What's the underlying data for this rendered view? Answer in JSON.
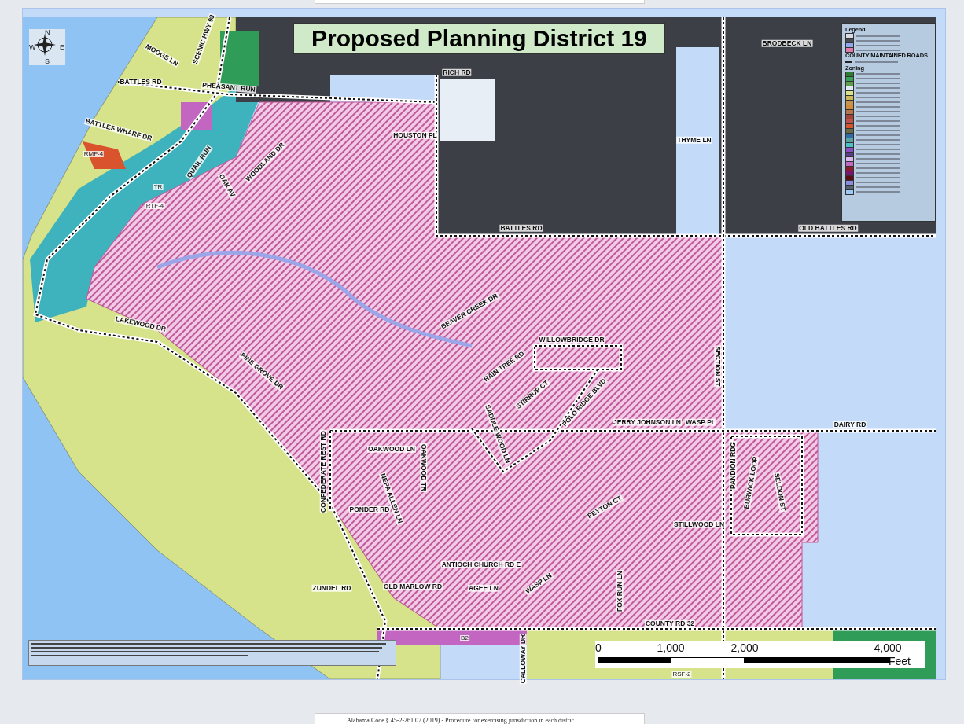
{
  "map": {
    "title": "Proposed Planning District 19",
    "compass": {
      "north": "N",
      "south": "S",
      "east": "E",
      "west": "W"
    },
    "labels": [
      {
        "text": "MOOGS LN",
        "kind": "road"
      },
      {
        "text": "SCENIC HWY 98",
        "kind": "road"
      },
      {
        "text": "BATTLES RD",
        "kind": "road"
      },
      {
        "text": "PHEASANT RUN",
        "kind": "road"
      },
      {
        "text": "BATTLES WHARF DR",
        "kind": "road"
      },
      {
        "text": "RMF-4",
        "kind": "zone"
      },
      {
        "text": "TR",
        "kind": "zone"
      },
      {
        "text": "RTF-4",
        "kind": "zone"
      },
      {
        "text": "QUAIL RUN",
        "kind": "road"
      },
      {
        "text": "OAK AV",
        "kind": "road"
      },
      {
        "text": "WOODLAND DR",
        "kind": "road"
      },
      {
        "text": "RICH RD",
        "kind": "road"
      },
      {
        "text": "HOUSTON PL",
        "kind": "road"
      },
      {
        "text": "BRODBECK LN",
        "kind": "road"
      },
      {
        "text": "THYME LN",
        "kind": "road"
      },
      {
        "text": "BATTLES RD",
        "kind": "road"
      },
      {
        "text": "OLD BATTLES RD",
        "kind": "road"
      },
      {
        "text": "LAKEWOOD DR",
        "kind": "road"
      },
      {
        "text": "PINE GROVE DR",
        "kind": "road"
      },
      {
        "text": "BEAVER CREEK DR",
        "kind": "road"
      },
      {
        "text": "WILLOWBRIDGE DR",
        "kind": "road"
      },
      {
        "text": "RAIN TREE RD",
        "kind": "road"
      },
      {
        "text": "STIRRUP CT",
        "kind": "road"
      },
      {
        "text": "SADDLE WOOD LN",
        "kind": "road"
      },
      {
        "text": "POLO RIDGE BLVD",
        "kind": "road"
      },
      {
        "text": "SECTION ST",
        "kind": "road"
      },
      {
        "text": "JERRY JOHNSON LN",
        "kind": "road"
      },
      {
        "text": "WASP PL",
        "kind": "road"
      },
      {
        "text": "DAIRY RD",
        "kind": "road"
      },
      {
        "text": "OAKWOOD LN",
        "kind": "road"
      },
      {
        "text": "OAKWOOD TR",
        "kind": "road"
      },
      {
        "text": "CONFEDERATE REST RD",
        "kind": "road"
      },
      {
        "text": "NEPA ALLEN LN",
        "kind": "road"
      },
      {
        "text": "PONDER RD",
        "kind": "road"
      },
      {
        "text": "PANDION RDG",
        "kind": "road"
      },
      {
        "text": "BURWICK LOOP",
        "kind": "road"
      },
      {
        "text": "SELDON ST",
        "kind": "road"
      },
      {
        "text": "PEYTON CT",
        "kind": "road"
      },
      {
        "text": "STILLWOOD LN",
        "kind": "road"
      },
      {
        "text": "ANTIOCH CHURCH RD E",
        "kind": "road"
      },
      {
        "text": "ZUNDEL RD",
        "kind": "road"
      },
      {
        "text": "OLD MARLOW RD",
        "kind": "road"
      },
      {
        "text": "AGEE LN",
        "kind": "road"
      },
      {
        "text": "WASP LN",
        "kind": "road"
      },
      {
        "text": "FOX RUN LN",
        "kind": "road"
      },
      {
        "text": "COUNTY RD 32",
        "kind": "road"
      },
      {
        "text": "B2",
        "kind": "zone"
      },
      {
        "text": "CALLOWAY DR",
        "kind": "road"
      },
      {
        "text": "RSF-2",
        "kind": "zone"
      }
    ],
    "legend": {
      "title": "Legend",
      "roads_heading": "COUNTY MAINTAINED ROADS",
      "zoning_heading": "Zoning",
      "swatches": [
        {
          "color": "#d9dde3"
        },
        {
          "color": "#4a4d52"
        },
        {
          "color": "#8fa6f0"
        },
        {
          "color": "#e07aa8"
        }
      ],
      "zones": [
        {
          "color": "#2e7d32"
        },
        {
          "color": "#3aa35a"
        },
        {
          "color": "#5c9e4a"
        },
        {
          "color": "#dfe8f5"
        },
        {
          "color": "#d8e28a"
        },
        {
          "color": "#c9b85a"
        },
        {
          "color": "#c8934f"
        },
        {
          "color": "#d08a3c"
        },
        {
          "color": "#b8734a"
        },
        {
          "color": "#a0453a"
        },
        {
          "color": "#c0504a"
        },
        {
          "color": "#d9532c"
        },
        {
          "color": "#6b6b4a"
        },
        {
          "color": "#2f6da8"
        },
        {
          "color": "#5aa3a0"
        },
        {
          "color": "#4cc0c6"
        },
        {
          "color": "#8a4fc2"
        },
        {
          "color": "#5a3d8f"
        },
        {
          "color": "#d9b8f0"
        },
        {
          "color": "#c266c2"
        },
        {
          "color": "#8c1a2e"
        },
        {
          "color": "#7a1470"
        },
        {
          "color": "#5a0e14"
        },
        {
          "color": "#8c8cdc"
        },
        {
          "color": "#556070"
        },
        {
          "color": "#9cc9f5"
        }
      ]
    },
    "scale": {
      "ticks": [
        "0",
        "1,000",
        "2,000",
        "4,000"
      ],
      "unit": "Feet"
    }
  },
  "footer": {
    "caption": "Alabama Code § 45-2-261.07 (2019) - Procedure for exercising jurisdiction in each distric"
  }
}
